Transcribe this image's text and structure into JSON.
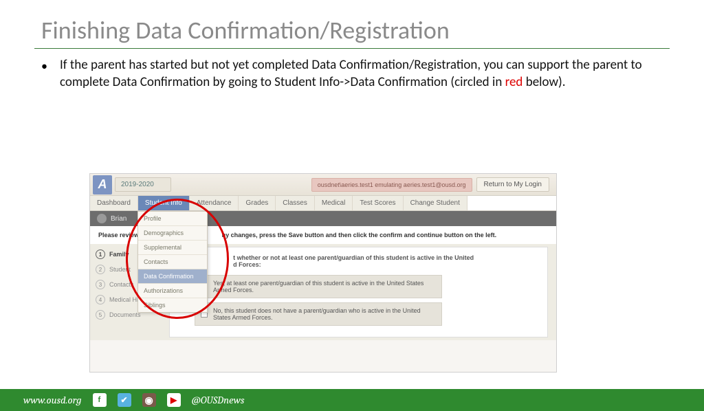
{
  "title": "Finishing Data Confirmation/Registration",
  "bullet": {
    "pre": "If the parent has started but not yet completed Data Confirmation/Registration, you can support the parent to complete Data Confirmation by going to Student Info->Data Confirmation (circled in ",
    "red_word": "red",
    "post": " below)."
  },
  "screenshot": {
    "logo_letter": "A",
    "year": "2019-2020",
    "emulating": "ousdnet\\aeries.test1 emulating aeries.test1@ousd.org",
    "return_btn": "Return to My Login",
    "nav": [
      "Dashboard",
      "Student Info",
      "Attendance",
      "Grades",
      "Classes",
      "Medical",
      "Test Scores",
      "Change Student"
    ],
    "nav_active_index": 1,
    "student_bar": "Brian",
    "dropdown": [
      "Profile",
      "Demographics",
      "Supplemental",
      "Contacts",
      "Data Confirmation",
      "Authorizations",
      "Siblings"
    ],
    "dropdown_hl_index": 4,
    "instructions": {
      "pre": "Please review t",
      "post": "ny changes, press the Save button and then click the confirm and continue button on the left."
    },
    "tabs": [
      {
        "n": "1",
        "label": "Family"
      },
      {
        "n": "2",
        "label": "Student"
      },
      {
        "n": "3",
        "label": "Contacts"
      },
      {
        "n": "4",
        "label": "Medical History"
      },
      {
        "n": "5",
        "label": "Documents"
      }
    ],
    "question": {
      "pre": "t whether or not at least one parent/guardian of this student is active in the United",
      "line2": "d Forces:"
    },
    "options": [
      "Yes, at least one parent/guardian of this student is active in the United States Armed Forces.",
      "No, this student does not have a parent/guardian who is active in the United States Armed Forces."
    ]
  },
  "footer": {
    "url": "www.ousd.org",
    "handle": "@OUSDnews"
  }
}
